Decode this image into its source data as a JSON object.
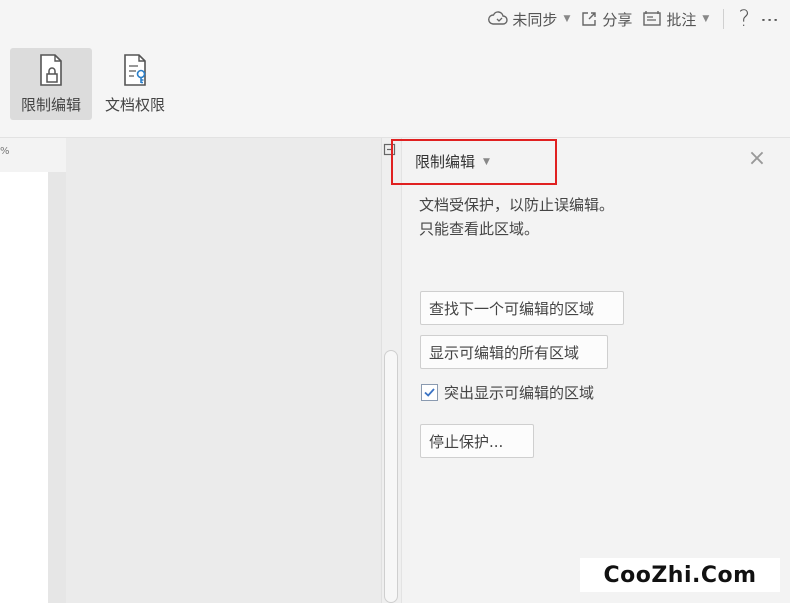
{
  "topbar": {
    "sync_label": "未同步",
    "share_label": "分享",
    "comment_label": "批注",
    "help_label": "?",
    "more_label": "⋮"
  },
  "ribbon": {
    "restrict_edit_label": "限制编辑",
    "doc_permission_label": "文档权限"
  },
  "ruler": {
    "fragment": "%"
  },
  "panel": {
    "title": "限制编辑",
    "close_label": "×",
    "description_line1": "文档受保护，以防止误编辑。",
    "description_line2": "只能查看此区域。",
    "find_next_label": "查找下一个可编辑的区域",
    "show_all_label": "显示可编辑的所有区域",
    "highlight_label": "突出显示可编辑的区域",
    "highlight_checked": true,
    "stop_protect_label": "停止保护..."
  },
  "watermark": {
    "text": "CooZhi.Com"
  },
  "colors": {
    "highlight_border": "#e02020",
    "checkbox_mark": "#3b73c4"
  }
}
